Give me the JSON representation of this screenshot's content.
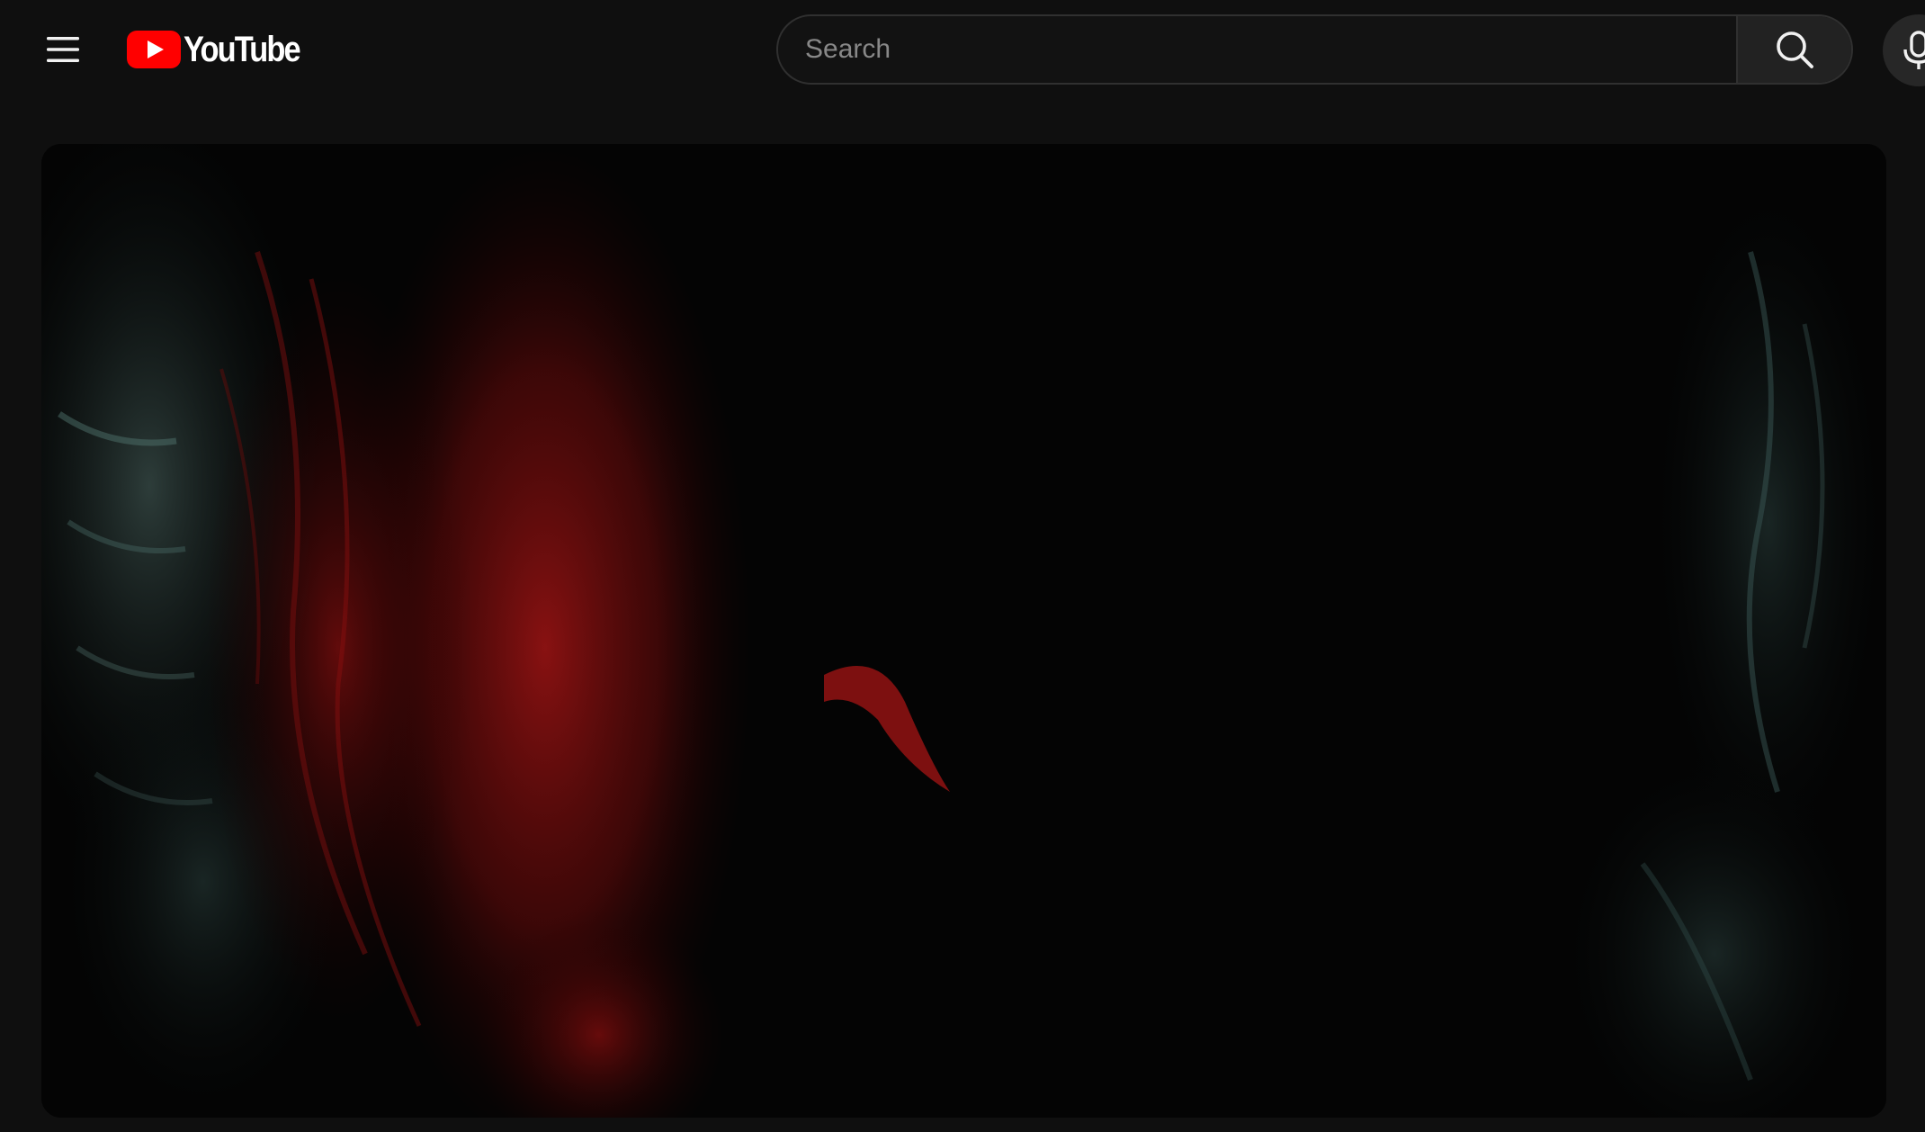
{
  "header": {
    "logo_text": "YouTube",
    "search": {
      "placeholder": "Search",
      "value": ""
    },
    "icons": {
      "menu": "hamburger-menu-icon",
      "search": "search-icon",
      "voice": "microphone-icon"
    }
  },
  "player": {
    "frame_description_icon": "video-frame"
  },
  "colors": {
    "background": "#0f0f0f",
    "brand_red": "#ff0000",
    "search_border": "#303030",
    "search_button_bg": "#222222",
    "placeholder_text": "#888888",
    "icon_color": "#f1f1f1"
  }
}
